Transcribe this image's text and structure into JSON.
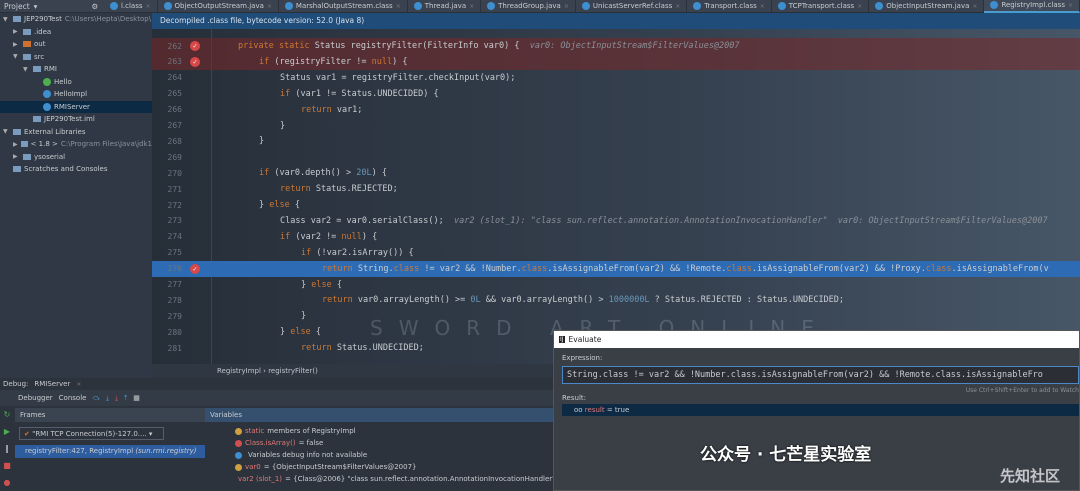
{
  "toolbar": {
    "project_label": "Project"
  },
  "tabs": [
    "l.class",
    "ObjectOutputStream.java",
    "MarshalOutputStream.class",
    "Thread.java",
    "ThreadGroup.java",
    "UnicastServerRef.class",
    "Transport.class",
    "TCPTransport.class",
    "ObjectInputStream.java",
    "RegistryImpl.class"
  ],
  "active_tab": 9,
  "project_tree": [
    {
      "label": "JEP290Test",
      "path": "C:\\Users\\Hepta\\Desktop\\",
      "indent": 0,
      "arrow": "▼"
    },
    {
      "label": ".idea",
      "indent": 1,
      "arrow": "▶"
    },
    {
      "label": "out",
      "indent": 1,
      "arrow": "▶"
    },
    {
      "label": "src",
      "indent": 1,
      "arrow": "▼"
    },
    {
      "label": "RMI",
      "indent": 2,
      "arrow": "▼"
    },
    {
      "label": "Hello",
      "indent": 3,
      "arrow": ""
    },
    {
      "label": "HelloImpl",
      "indent": 3,
      "arrow": ""
    },
    {
      "label": "RMIServer",
      "indent": 3,
      "arrow": "",
      "selected": true
    },
    {
      "label": "JEP290Test.iml",
      "indent": 2,
      "arrow": ""
    },
    {
      "label": "External Libraries",
      "indent": 0,
      "arrow": "▼"
    },
    {
      "label": "< 1.8 >",
      "path": "C:\\Program Files\\Java\\jdk1",
      "indent": 1,
      "arrow": "▶"
    },
    {
      "label": "ysoserial",
      "indent": 1,
      "arrow": "▶"
    },
    {
      "label": "Scratches and Consoles",
      "indent": 0,
      "arrow": ""
    }
  ],
  "notice": "Decompiled .class file, bytecode version: 52.0 (Java 8)",
  "code": [
    {
      "n": "262",
      "bp": true,
      "ind": 0,
      "seg": [
        [
          "kw",
          "private static "
        ],
        [
          "pl",
          "Status registryFilter(FilterInfo var0) {  "
        ],
        [
          "hint",
          "var0: ObjectInputStream$FilterValues@2007"
        ]
      ]
    },
    {
      "n": "263",
      "bp": true,
      "ind": 1,
      "seg": [
        [
          "kw",
          "if "
        ],
        [
          "pl",
          "(registryFilter != "
        ],
        [
          "kw",
          "null"
        ],
        [
          "pl",
          ") {"
        ]
      ]
    },
    {
      "n": "264",
      "ind": 2,
      "seg": [
        [
          "pl",
          "Status var1 = registryFilter.checkInput(var0);"
        ]
      ]
    },
    {
      "n": "265",
      "ind": 2,
      "seg": [
        [
          "kw",
          "if "
        ],
        [
          "pl",
          "(var1 != Status.UNDECIDED) {"
        ]
      ]
    },
    {
      "n": "266",
      "ind": 3,
      "seg": [
        [
          "kw",
          "return "
        ],
        [
          "pl",
          "var1;"
        ]
      ]
    },
    {
      "n": "267",
      "ind": 2,
      "seg": [
        [
          "pl",
          "}"
        ]
      ]
    },
    {
      "n": "268",
      "ind": 1,
      "seg": [
        [
          "pl",
          "}"
        ]
      ]
    },
    {
      "n": "269",
      "ind": 0,
      "seg": []
    },
    {
      "n": "270",
      "ind": 1,
      "seg": [
        [
          "kw",
          "if "
        ],
        [
          "pl",
          "(var0.depth() > "
        ],
        [
          "num",
          "20L"
        ],
        [
          "pl",
          ") {"
        ]
      ]
    },
    {
      "n": "271",
      "ind": 2,
      "seg": [
        [
          "kw",
          "return "
        ],
        [
          "pl",
          "Status.REJECTED;"
        ]
      ]
    },
    {
      "n": "272",
      "ind": 1,
      "seg": [
        [
          "pl",
          "} "
        ],
        [
          "kw",
          "else "
        ],
        [
          "pl",
          "{"
        ]
      ]
    },
    {
      "n": "273",
      "ind": 2,
      "seg": [
        [
          "pl",
          "Class var2 = var0.serialClass();  "
        ],
        [
          "hint",
          "var2 (slot_1): \"class sun.reflect.annotation.AnnotationInvocationHandler\"  var0: ObjectInputStream$FilterValues@2007"
        ]
      ]
    },
    {
      "n": "274",
      "ind": 2,
      "seg": [
        [
          "kw",
          "if "
        ],
        [
          "pl",
          "(var2 != "
        ],
        [
          "kw",
          "null"
        ],
        [
          "pl",
          ") {"
        ]
      ]
    },
    {
      "n": "275",
      "ind": 3,
      "seg": [
        [
          "kw",
          "if "
        ],
        [
          "pl",
          "(!var2.isArray()) {"
        ]
      ]
    },
    {
      "n": "276",
      "bp": true,
      "cur": true,
      "ind": 4,
      "seg": [
        [
          "kw",
          "return "
        ],
        [
          "pl",
          "String."
        ],
        [
          "kw",
          "class"
        ],
        [
          "pl",
          " != var2 && !Number."
        ],
        [
          "kw",
          "class"
        ],
        [
          "pl",
          ".isAssignableFrom(var2) && !Remote."
        ],
        [
          "kw",
          "class"
        ],
        [
          "pl",
          ".isAssignableFrom(var2) && !Proxy."
        ],
        [
          "kw",
          "class"
        ],
        [
          "pl",
          ".isAssignableFrom(v"
        ]
      ]
    },
    {
      "n": "277",
      "ind": 3,
      "seg": [
        [
          "pl",
          "} "
        ],
        [
          "kw",
          "else "
        ],
        [
          "pl",
          "{"
        ]
      ]
    },
    {
      "n": "278",
      "ind": 4,
      "seg": [
        [
          "kw",
          "return "
        ],
        [
          "pl",
          "var0.arrayLength() >= "
        ],
        [
          "num",
          "0L"
        ],
        [
          "pl",
          " && var0.arrayLength() > "
        ],
        [
          "num",
          "1000000L"
        ],
        [
          "pl",
          " ? Status.REJECTED : Status.UNDECIDED;"
        ]
      ]
    },
    {
      "n": "279",
      "ind": 3,
      "seg": [
        [
          "pl",
          "}"
        ]
      ]
    },
    {
      "n": "280",
      "ind": 2,
      "seg": [
        [
          "pl",
          "} "
        ],
        [
          "kw",
          "else "
        ],
        [
          "pl",
          "{"
        ]
      ]
    },
    {
      "n": "281",
      "ind": 3,
      "seg": [
        [
          "kw",
          "return "
        ],
        [
          "pl",
          "Status.UNDECIDED;"
        ]
      ]
    }
  ],
  "breadcrumb": [
    "RegistryImpl",
    "registryFilter()"
  ],
  "background_watermark": "SWORD ART ONLINE",
  "debug": {
    "title": "Debug:",
    "config": "RMIServer",
    "tabs": [
      "Debugger",
      "Console"
    ],
    "frames_label": "Frames",
    "variables_label": "Variables",
    "thread": "\"RMI TCP Connection(5)-127.0....",
    "frame": "registryFilter:427, RegistryImpl",
    "frame_pkg": "(sun.rmi.registry)",
    "variables": [
      {
        "icon": "static",
        "color": "#d0a040",
        "name": "static",
        "value": "members of RegistryImpl"
      },
      {
        "icon": "watch",
        "color": "#d05050",
        "name": "Class.isArray()",
        "value": "= false"
      },
      {
        "icon": "info",
        "color": "#3d8fd0",
        "name": "",
        "value": "Variables debug info not available"
      },
      {
        "icon": "param",
        "color": "#d0a040",
        "name": "var0",
        "value": "= {ObjectInputStream$FilterValues@2007}"
      },
      {
        "icon": "field",
        "color": "#d0a040",
        "name": "var2 (slot_1)",
        "value": "= {Class@2006} \"class sun.reflect.annotation.AnnotationInvocationHandler\""
      }
    ]
  },
  "evaluate": {
    "title": "Evaluate",
    "expression_label": "Expression:",
    "expression": "String.class != var2 && !Number.class.isAssignableFrom(var2) && !Remote.class.isAssignableFro",
    "hint": "Use Ctrl+Shift+Enter to add to Watch",
    "result_label": "Result:",
    "result_name": "result",
    "result_value": "= true"
  },
  "watermark": "公众号 · 七芒星实验室",
  "watermark2": "先知社区"
}
